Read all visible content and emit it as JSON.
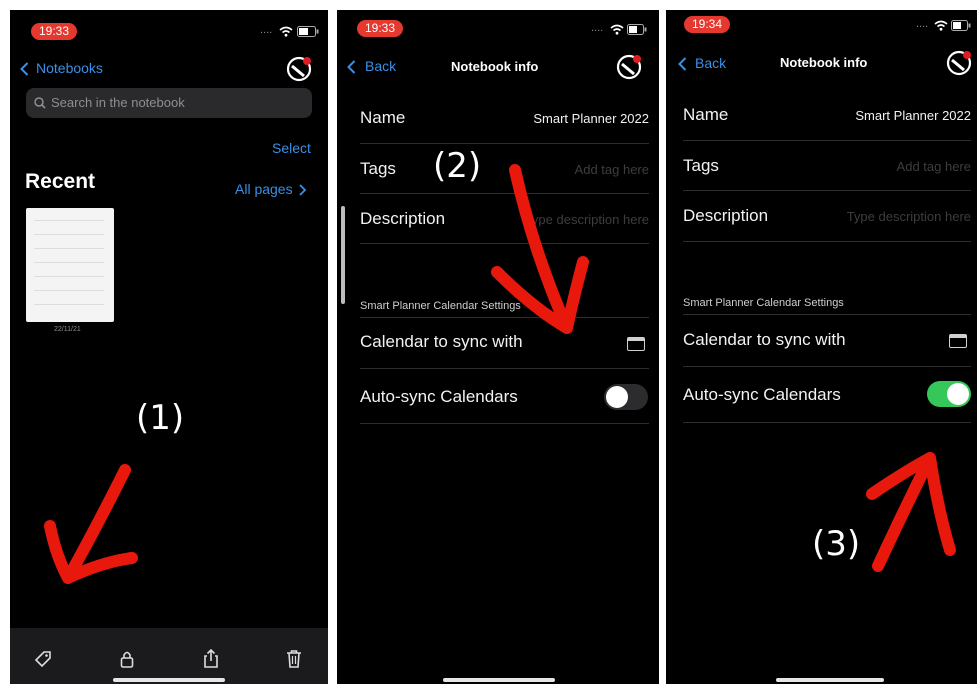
{
  "panel1": {
    "time": "19:33",
    "back_label": "Notebooks",
    "search_placeholder": "Search in the notebook",
    "select_label": "Select",
    "recent_title": "Recent",
    "all_pages_label": "All pages",
    "thumbnail_date": "22/11/21",
    "annotation": "(1)"
  },
  "panel2": {
    "time": "19:33",
    "back_label": "Back",
    "title": "Notebook info",
    "name_label": "Name",
    "name_value": "Smart Planner 2022",
    "tags_label": "Tags",
    "tags_placeholder": "Add tag here",
    "description_label": "Description",
    "description_placeholder": "Type description here",
    "section_title": "Smart Planner Calendar Settings",
    "calendar_label": "Calendar to sync with",
    "autosync_label": "Auto-sync Calendars",
    "autosync_on": false,
    "annotation": "(2)"
  },
  "panel3": {
    "time": "19:34",
    "back_label": "Back",
    "title": "Notebook info",
    "name_label": "Name",
    "name_value": "Smart Planner 2022",
    "tags_label": "Tags",
    "tags_placeholder": "Add tag here",
    "description_label": "Description",
    "description_placeholder": "Type description here",
    "section_title": "Smart Planner Calendar Settings",
    "calendar_label": "Calendar to sync with",
    "autosync_label": "Auto-sync Calendars",
    "autosync_on": true,
    "annotation": "(3)"
  },
  "colors": {
    "accent_blue": "#3a8fe6",
    "toggle_on": "#35c759",
    "annotation_red": "#e8180c",
    "time_pill": "#e5382f"
  },
  "icons": [
    "tag-icon",
    "lock-icon",
    "share-icon",
    "trash-icon",
    "calendar-icon",
    "wifi-icon",
    "battery-icon",
    "app-logo-icon",
    "chevron-left-icon",
    "chevron-right-icon",
    "search-icon"
  ]
}
